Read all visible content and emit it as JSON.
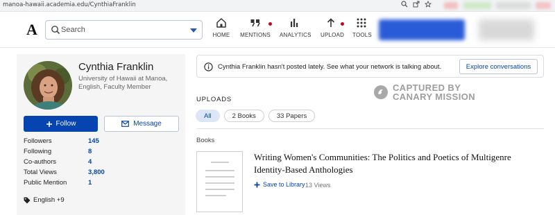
{
  "browser": {
    "url": "manoa-hawaii.academia.edu/CynthiaFranklin",
    "icons": [
      "zoom-icon",
      "share-icon",
      "star-icon"
    ]
  },
  "header": {
    "logo": "A",
    "search_placeholder": "Search",
    "nav": [
      {
        "label": "HOME",
        "icon": "home-icon",
        "dot": false
      },
      {
        "label": "MENTIONS",
        "icon": "mentions-icon",
        "dot": true
      },
      {
        "label": "ANALYTICS",
        "icon": "analytics-icon",
        "dot": false
      },
      {
        "label": "UPLOAD",
        "icon": "upload-icon",
        "dot": true
      },
      {
        "label": "TOOLS",
        "icon": "tools-icon",
        "dot": false
      }
    ]
  },
  "profile": {
    "name": "Cynthia Franklin",
    "affiliation": "University of Hawaii at Manoa, English, Faculty Member",
    "follow_label": "Follow",
    "message_label": "Message",
    "stats": [
      {
        "label": "Followers",
        "value": "145"
      },
      {
        "label": "Following",
        "value": "8"
      },
      {
        "label": "Co-authors",
        "value": "4"
      },
      {
        "label": "Total Views",
        "value": "3,800"
      },
      {
        "label": "Public Mention",
        "value": "1"
      }
    ],
    "languages": "English +9"
  },
  "notice": {
    "text": "Cynthia Franklin hasn't posted lately. See what your network is talking about.",
    "button": "Explore conversations"
  },
  "uploads": {
    "heading": "UPLOADS",
    "filters": [
      "All",
      "2 Books",
      "33 Papers"
    ],
    "active_filter": "All",
    "section": "Books",
    "items": [
      {
        "title": "Writing Women's Communities: The Politics and Poetics of Multigenre Identity-Based Anthologies",
        "save_label": "Save to Library",
        "views": "13 Views"
      }
    ]
  },
  "watermark": {
    "line1": "CAPTURED BY",
    "line2": "CANARY MISSION"
  },
  "colors": {
    "accent": "#0645b1",
    "notification_dot": "#d0021b",
    "profile_bg": "#f5f5f5"
  }
}
